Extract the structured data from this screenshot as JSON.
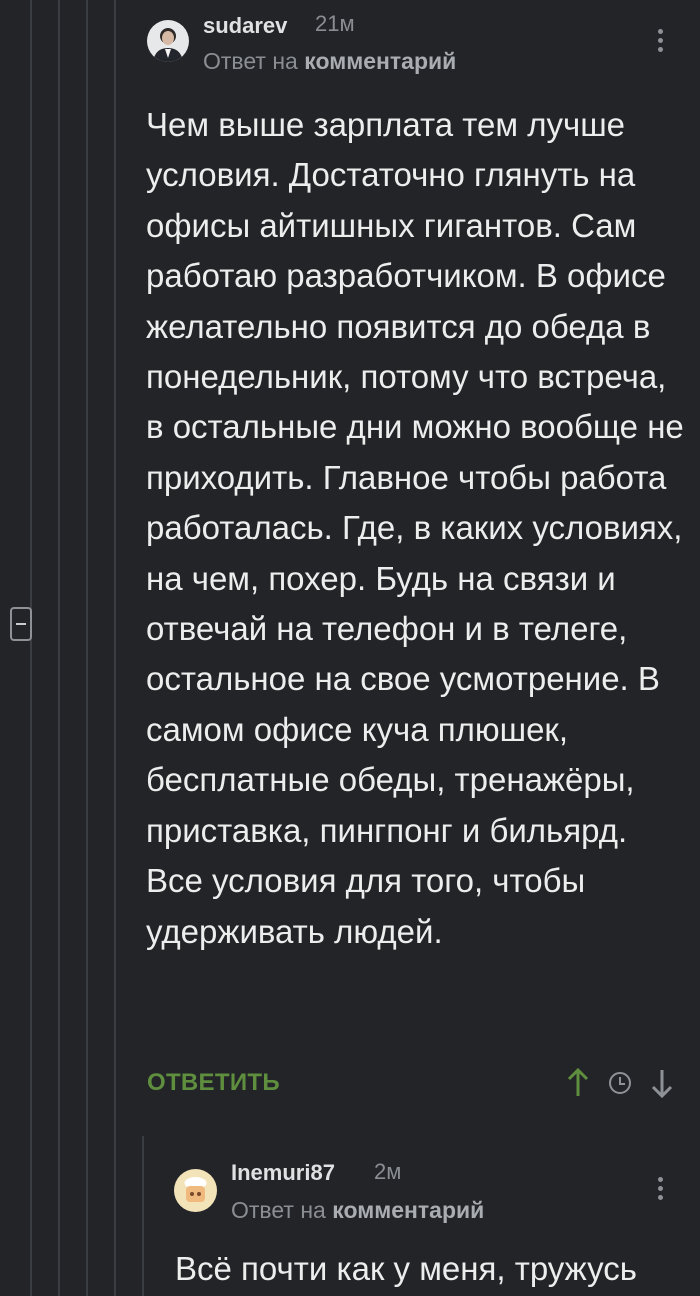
{
  "comment": {
    "username": "sudarev",
    "time": "21м",
    "reply_prefix": "Ответ на",
    "reply_link": "комментарий",
    "text": "Чем выше зарплата тем лучше условия. Достаточно глянуть на офисы айтишных гигантов. Сам работаю разработчиком. В офисе желательно появится до обеда в понедельник, потому что встреча, в остальные дни можно вообще не приходить. Главное чтобы работа работалась. Где, в каких условиях, на чем, похер. Будь на связи и отвечай на телефон и в телеге, остальное на свое усмотрение. В самом офисе куча плюшек, бесплатные обеды, тренажёры, приставка, пингпонг и бильярд. Все условия для того, чтобы удерживать людей.",
    "reply_button": "ОТВЕТИТЬ"
  },
  "reply": {
    "username": "Inemuri87",
    "time": "2м",
    "reply_prefix": "Ответ на",
    "reply_link": "комментарий",
    "text_preview": "Всё почти как у меня, тружусь"
  },
  "colors": {
    "background": "#222427",
    "accent_green": "#5e8e3e",
    "muted": "#8a8e93"
  },
  "icons": [
    "collapse-icon",
    "kebab-menu-icon",
    "upvote-arrow-icon",
    "clock-icon",
    "downvote-arrow-icon"
  ]
}
